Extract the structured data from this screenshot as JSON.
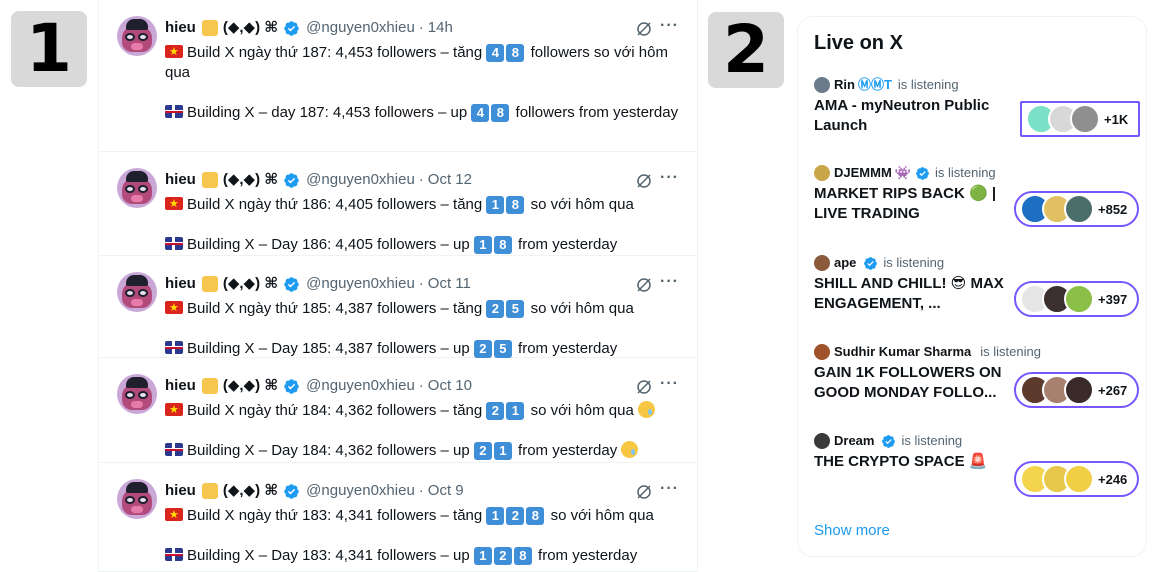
{
  "labels": {
    "left_panel_number": "1",
    "right_panel_number": "2"
  },
  "feed": {
    "tweets": [
      {
        "name": "hieu",
        "extra": "(◆,◆) ⌘",
        "handle": "@nguyen0xhieu",
        "time": "14h",
        "vn_text": "Build X ngày thứ 187: 4,453 followers – tăng",
        "vn_digits": [
          "4",
          "8"
        ],
        "vn_suffix": "followers so với hôm qua",
        "en_text": "Building X – day 187: 4,453 followers – up",
        "en_digits": [
          "4",
          "8"
        ],
        "en_suffix": "followers from yesterday"
      },
      {
        "name": "hieu",
        "extra": "(◆,◆) ⌘",
        "handle": "@nguyen0xhieu",
        "time": "Oct 12",
        "vn_text": "Build X ngày thứ 186: 4,405 followers – tăng",
        "vn_digits": [
          "1",
          "8"
        ],
        "vn_suffix": "so với hôm qua",
        "en_text": "Building X – Day 186: 4,405 followers – up",
        "en_digits": [
          "1",
          "8"
        ],
        "en_suffix": "from yesterday"
      },
      {
        "name": "hieu",
        "extra": "(◆,◆) ⌘",
        "handle": "@nguyen0xhieu",
        "time": "Oct 11",
        "vn_text": "Build X ngày thứ 185: 4,387 followers – tăng",
        "vn_digits": [
          "2",
          "5"
        ],
        "vn_suffix": "so với hôm qua",
        "en_text": "Building X – Day 185: 4,387 followers – up",
        "en_digits": [
          "2",
          "5"
        ],
        "en_suffix": "from yesterday"
      },
      {
        "name": "hieu",
        "extra": "(◆,◆) ⌘",
        "handle": "@nguyen0xhieu",
        "time": "Oct 10",
        "vn_text": "Build X ngày thứ 184: 4,362 followers – tăng",
        "vn_digits": [
          "2",
          "1"
        ],
        "vn_suffix": "so với hôm qua",
        "en_text": "Building X – Day 184: 4,362 followers – up",
        "en_digits": [
          "2",
          "1"
        ],
        "en_suffix": "from yesterday"
      },
      {
        "name": "hieu",
        "extra": "(◆,◆) ⌘",
        "handle": "@nguyen0xhieu",
        "time": "Oct 9",
        "vn_text": "Build X ngày thứ 183: 4,341 followers – tăng",
        "vn_digits": [
          "1",
          "2",
          "8"
        ],
        "vn_suffix": "so với hôm qua",
        "en_text": "Building X – Day 183: 4,341 followers – up",
        "en_digits": [
          "1",
          "2",
          "8"
        ],
        "en_suffix": "from yesterday"
      }
    ],
    "dot": "·",
    "more_glyph": "···"
  },
  "live": {
    "title": "Live on X",
    "listening_label": "is listening",
    "spaces": [
      {
        "host": "Rin",
        "host_extra": "ⓂⓂT",
        "title": "AMA - myNeutron Public Launch",
        "count": "+1K"
      },
      {
        "host": "DJEMMM",
        "host_extra": "👾",
        "title": "MARKET RIPS BACK 🟢 | LIVE TRADING",
        "count": "+852"
      },
      {
        "host": "ape",
        "host_extra": "",
        "title": "SHILL AND CHILL! 😎 MAX ENGAGEMENT, ...",
        "count": "+397"
      },
      {
        "host": "Sudhir Kumar Sharma",
        "host_extra": "",
        "title": "GAIN 1K FOLLOWERS ON GOOD MONDAY FOLLO...",
        "count": "+267"
      },
      {
        "host": "Dream",
        "host_extra": "",
        "title": "THE CRYPTO SPACE 🚨",
        "count": "+246"
      }
    ],
    "show_more": "Show more"
  },
  "colors": {
    "accent": "#1d9bf0",
    "space_border": "#7856ff",
    "digit_box": "#3f8ed8",
    "number_badge": "#d9d9d9"
  }
}
